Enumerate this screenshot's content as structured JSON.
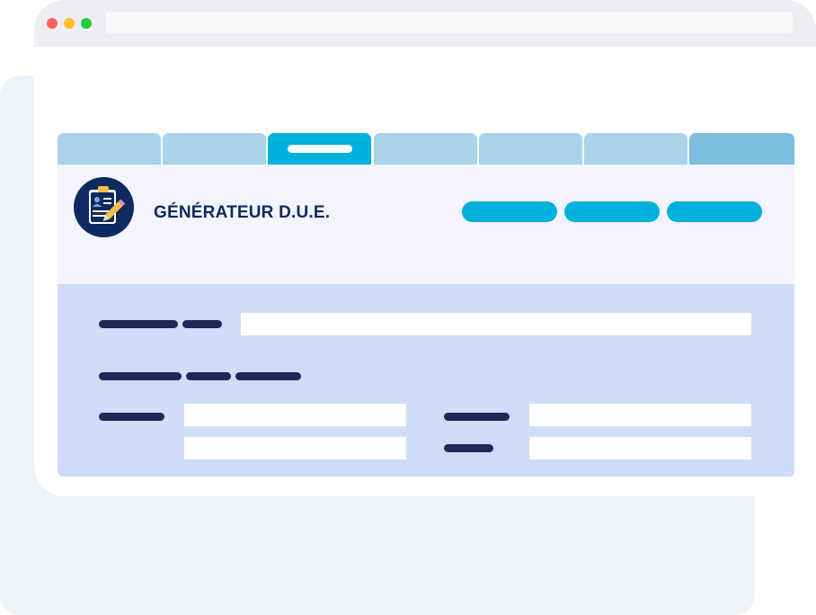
{
  "app": {
    "title": "GÉNÉRATEUR D.U.E.",
    "logo_icon": "clipboard-id-pencil-icon"
  },
  "tabs": [
    {
      "state": "inactive"
    },
    {
      "state": "inactive"
    },
    {
      "state": "active"
    },
    {
      "state": "inactive"
    },
    {
      "state": "inactive"
    },
    {
      "state": "inactive"
    },
    {
      "state": "inactive"
    }
  ],
  "header_buttons": [
    {
      "label": ""
    },
    {
      "label": ""
    },
    {
      "label": ""
    }
  ],
  "form": {
    "fields": [
      {
        "value": ""
      },
      {
        "value": ""
      },
      {
        "value": ""
      },
      {
        "value": ""
      },
      {
        "value": ""
      }
    ]
  },
  "colors": {
    "accent": "#00b1dc",
    "brand_navy": "#0e2a5e",
    "tab": "#a9d3ea",
    "form_panel": "#cfddf7",
    "header_panel": "#f3f4fd"
  }
}
